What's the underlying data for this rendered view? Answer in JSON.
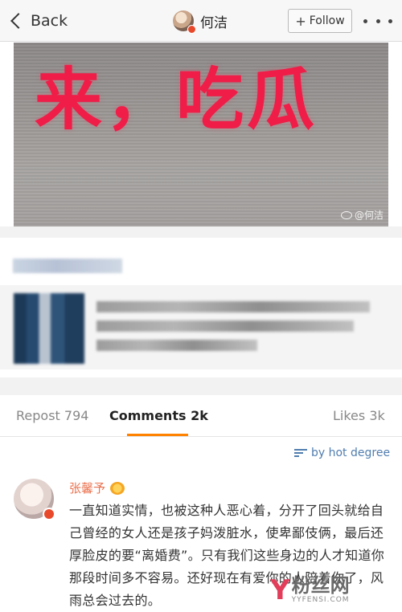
{
  "nav": {
    "back_label": "Back",
    "user_name": "何洁",
    "follow_label": "Follow"
  },
  "photo": {
    "caption": "来，吃瓜",
    "watermark": "@何洁"
  },
  "tabs": {
    "repost": "Repost 794",
    "comments": "Comments 2k",
    "likes": "Likes 3k"
  },
  "sort_label": "by hot degree",
  "comment": {
    "author": "张馨予",
    "text": "一直知道实情，也被这种人恶心着，分开了回头就给自己曾经的女人还是孩子妈泼脏水，使卑鄙伎俩，最后还厚脸皮的要“离婚费”。只有我们这些身边的人才知道你那段时间多不容易。还好现在有爱你的人陪着你了，风雨总会过去的。"
  },
  "site_watermark": {
    "cn": "粉丝网",
    "en": "YYFENSI.COM"
  },
  "colors": {
    "accent": "#ff8200",
    "link": "#507daf",
    "author": "#eb7350",
    "caption_red": "#ef1d48"
  }
}
